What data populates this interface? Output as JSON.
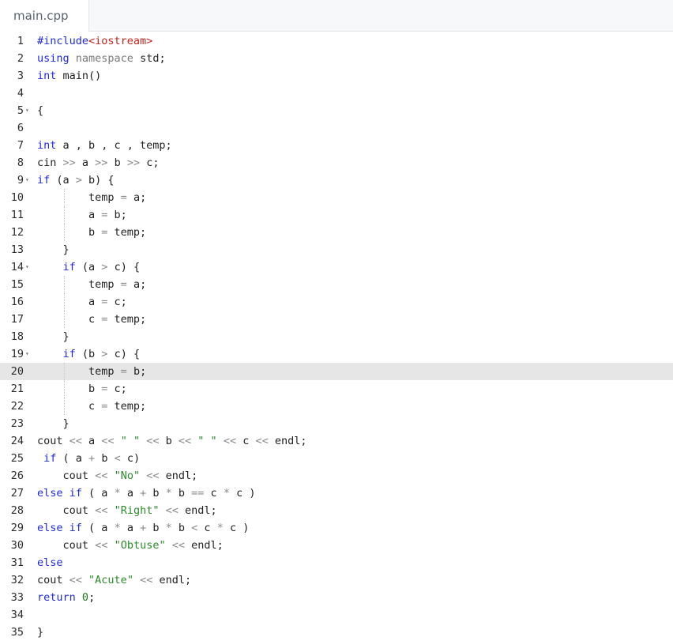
{
  "tab": {
    "label": "main.cpp"
  },
  "lines": [
    {
      "n": "1",
      "fold": false,
      "segs": [
        [
          "k",
          "#include"
        ],
        [
          "i",
          "<iostream>"
        ]
      ]
    },
    {
      "n": "2",
      "fold": false,
      "segs": [
        [
          "k",
          "using"
        ],
        [
          "p",
          " "
        ],
        [
          "m",
          "namespace"
        ],
        [
          "p",
          " std;"
        ]
      ]
    },
    {
      "n": "3",
      "fold": false,
      "segs": [
        [
          "t",
          "int"
        ],
        [
          "p",
          " main()"
        ]
      ]
    },
    {
      "n": "4",
      "fold": false,
      "segs": []
    },
    {
      "n": "5",
      "fold": true,
      "segs": [
        [
          "p",
          "{"
        ]
      ]
    },
    {
      "n": "6",
      "fold": false,
      "segs": []
    },
    {
      "n": "7",
      "fold": false,
      "segs": [
        [
          "t",
          "int"
        ],
        [
          "p",
          " a , b , c , temp;"
        ]
      ]
    },
    {
      "n": "8",
      "fold": false,
      "segs": [
        [
          "p",
          "cin "
        ],
        [
          "o",
          ">>"
        ],
        [
          "p",
          " a "
        ],
        [
          "o",
          ">>"
        ],
        [
          "p",
          " b "
        ],
        [
          "o",
          ">>"
        ],
        [
          "p",
          " c;"
        ]
      ]
    },
    {
      "n": "9",
      "fold": true,
      "segs": [
        [
          "k",
          "if"
        ],
        [
          "p",
          " (a "
        ],
        [
          "o",
          ">"
        ],
        [
          "p",
          " b) {"
        ]
      ]
    },
    {
      "n": "10",
      "fold": false,
      "segs": [
        [
          "p",
          "        temp "
        ],
        [
          "o",
          "="
        ],
        [
          "p",
          " a;"
        ]
      ]
    },
    {
      "n": "11",
      "fold": false,
      "segs": [
        [
          "p",
          "        a "
        ],
        [
          "o",
          "="
        ],
        [
          "p",
          " b;"
        ]
      ]
    },
    {
      "n": "12",
      "fold": false,
      "segs": [
        [
          "p",
          "        b "
        ],
        [
          "o",
          "="
        ],
        [
          "p",
          " temp;"
        ]
      ]
    },
    {
      "n": "13",
      "fold": false,
      "segs": [
        [
          "p",
          "    }"
        ]
      ]
    },
    {
      "n": "14",
      "fold": true,
      "segs": [
        [
          "p",
          "    "
        ],
        [
          "k",
          "if"
        ],
        [
          "p",
          " (a "
        ],
        [
          "o",
          ">"
        ],
        [
          "p",
          " c) {"
        ]
      ]
    },
    {
      "n": "15",
      "fold": false,
      "segs": [
        [
          "p",
          "        temp "
        ],
        [
          "o",
          "="
        ],
        [
          "p",
          " a;"
        ]
      ]
    },
    {
      "n": "16",
      "fold": false,
      "segs": [
        [
          "p",
          "        a "
        ],
        [
          "o",
          "="
        ],
        [
          "p",
          " c;"
        ]
      ]
    },
    {
      "n": "17",
      "fold": false,
      "segs": [
        [
          "p",
          "        c "
        ],
        [
          "o",
          "="
        ],
        [
          "p",
          " temp;"
        ]
      ]
    },
    {
      "n": "18",
      "fold": false,
      "segs": [
        [
          "p",
          "    }"
        ]
      ]
    },
    {
      "n": "19",
      "fold": true,
      "segs": [
        [
          "p",
          "    "
        ],
        [
          "k",
          "if"
        ],
        [
          "p",
          " (b "
        ],
        [
          "o",
          ">"
        ],
        [
          "p",
          " c) {"
        ]
      ]
    },
    {
      "n": "20",
      "fold": false,
      "active": true,
      "segs": [
        [
          "p",
          "        temp "
        ],
        [
          "o",
          "="
        ],
        [
          "p",
          " b;"
        ]
      ]
    },
    {
      "n": "21",
      "fold": false,
      "segs": [
        [
          "p",
          "        b "
        ],
        [
          "o",
          "="
        ],
        [
          "p",
          " c;"
        ]
      ]
    },
    {
      "n": "22",
      "fold": false,
      "segs": [
        [
          "p",
          "        c "
        ],
        [
          "o",
          "="
        ],
        [
          "p",
          " temp;"
        ]
      ]
    },
    {
      "n": "23",
      "fold": false,
      "segs": [
        [
          "p",
          "    }"
        ]
      ]
    },
    {
      "n": "24",
      "fold": false,
      "segs": [
        [
          "p",
          "cout "
        ],
        [
          "o",
          "<<"
        ],
        [
          "p",
          " a "
        ],
        [
          "o",
          "<<"
        ],
        [
          "p",
          " "
        ],
        [
          "s",
          "\" \""
        ],
        [
          "p",
          " "
        ],
        [
          "o",
          "<<"
        ],
        [
          "p",
          " b "
        ],
        [
          "o",
          "<<"
        ],
        [
          "p",
          " "
        ],
        [
          "s",
          "\" \""
        ],
        [
          "p",
          " "
        ],
        [
          "o",
          "<<"
        ],
        [
          "p",
          " c "
        ],
        [
          "o",
          "<<"
        ],
        [
          "p",
          " endl;"
        ]
      ]
    },
    {
      "n": "25",
      "fold": false,
      "segs": [
        [
          "p",
          " "
        ],
        [
          "k",
          "if"
        ],
        [
          "p",
          " ( a "
        ],
        [
          "o",
          "+"
        ],
        [
          "p",
          " b "
        ],
        [
          "o",
          "<"
        ],
        [
          "p",
          " c)"
        ]
      ]
    },
    {
      "n": "26",
      "fold": false,
      "segs": [
        [
          "p",
          "    cout "
        ],
        [
          "o",
          "<<"
        ],
        [
          "p",
          " "
        ],
        [
          "s",
          "\"No\""
        ],
        [
          "p",
          " "
        ],
        [
          "o",
          "<<"
        ],
        [
          "p",
          " endl;"
        ]
      ]
    },
    {
      "n": "27",
      "fold": false,
      "segs": [
        [
          "k",
          "else"
        ],
        [
          "p",
          " "
        ],
        [
          "k",
          "if"
        ],
        [
          "p",
          " ( a "
        ],
        [
          "o",
          "*"
        ],
        [
          "p",
          " a "
        ],
        [
          "o",
          "+"
        ],
        [
          "p",
          " b "
        ],
        [
          "o",
          "*"
        ],
        [
          "p",
          " b "
        ],
        [
          "o",
          "=="
        ],
        [
          "p",
          " c "
        ],
        [
          "o",
          "*"
        ],
        [
          "p",
          " c )"
        ]
      ]
    },
    {
      "n": "28",
      "fold": false,
      "segs": [
        [
          "p",
          "    cout "
        ],
        [
          "o",
          "<<"
        ],
        [
          "p",
          " "
        ],
        [
          "s",
          "\"Right\""
        ],
        [
          "p",
          " "
        ],
        [
          "o",
          "<<"
        ],
        [
          "p",
          " endl;"
        ]
      ]
    },
    {
      "n": "29",
      "fold": false,
      "segs": [
        [
          "k",
          "else"
        ],
        [
          "p",
          " "
        ],
        [
          "k",
          "if"
        ],
        [
          "p",
          " ( a "
        ],
        [
          "o",
          "*"
        ],
        [
          "p",
          " a "
        ],
        [
          "o",
          "+"
        ],
        [
          "p",
          " b "
        ],
        [
          "o",
          "*"
        ],
        [
          "p",
          " b "
        ],
        [
          "o",
          "<"
        ],
        [
          "p",
          " c "
        ],
        [
          "o",
          "*"
        ],
        [
          "p",
          " c )"
        ]
      ]
    },
    {
      "n": "30",
      "fold": false,
      "segs": [
        [
          "p",
          "    cout "
        ],
        [
          "o",
          "<<"
        ],
        [
          "p",
          " "
        ],
        [
          "s",
          "\"Obtuse\""
        ],
        [
          "p",
          " "
        ],
        [
          "o",
          "<<"
        ],
        [
          "p",
          " endl;"
        ]
      ]
    },
    {
      "n": "31",
      "fold": false,
      "segs": [
        [
          "k",
          "else"
        ]
      ]
    },
    {
      "n": "32",
      "fold": false,
      "segs": [
        [
          "p",
          "cout "
        ],
        [
          "o",
          "<<"
        ],
        [
          "p",
          " "
        ],
        [
          "s",
          "\"Acute\""
        ],
        [
          "p",
          " "
        ],
        [
          "o",
          "<<"
        ],
        [
          "p",
          " endl;"
        ]
      ]
    },
    {
      "n": "33",
      "fold": false,
      "segs": [
        [
          "k",
          "return"
        ],
        [
          "p",
          " "
        ],
        [
          "n",
          "0"
        ],
        [
          "p",
          ";"
        ]
      ]
    },
    {
      "n": "34",
      "fold": false,
      "segs": []
    },
    {
      "n": "35",
      "fold": false,
      "segs": [
        [
          "p",
          "}"
        ]
      ]
    }
  ]
}
